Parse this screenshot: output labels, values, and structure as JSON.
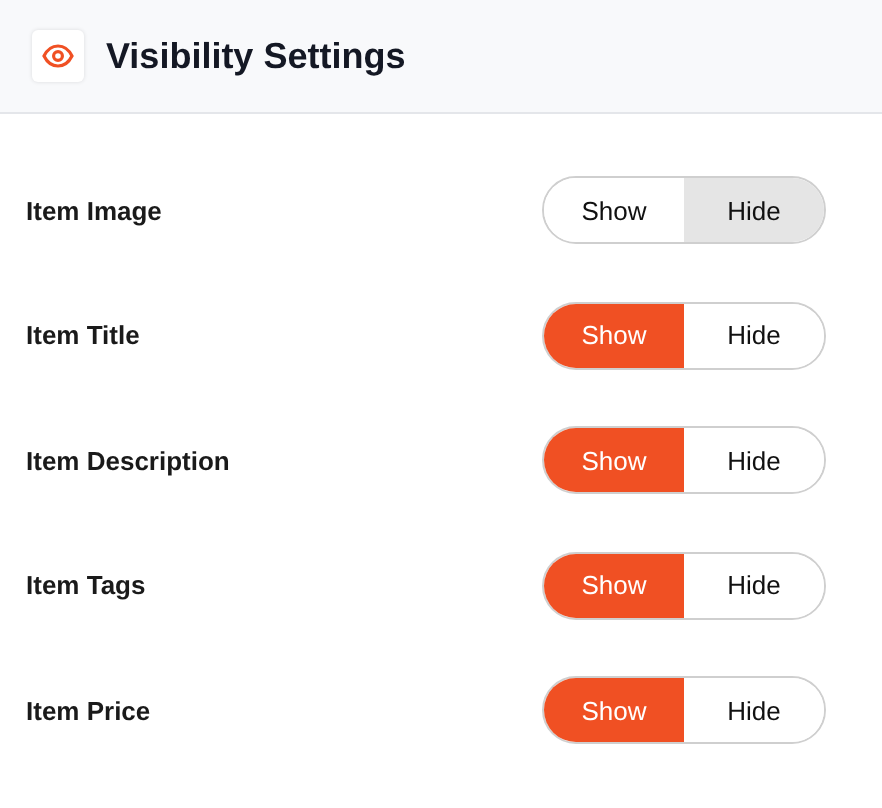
{
  "header": {
    "title": "Visibility Settings"
  },
  "settings": [
    {
      "label": "Item Image",
      "options": [
        {
          "kind": "show",
          "label": "Show",
          "selected": false
        },
        {
          "kind": "hide",
          "label": "Hide",
          "selected": true
        }
      ]
    },
    {
      "label": "Item Title",
      "options": [
        {
          "kind": "show",
          "label": "Show",
          "selected": true
        },
        {
          "kind": "hide",
          "label": "Hide",
          "selected": false
        }
      ]
    },
    {
      "label": "Item Description",
      "options": [
        {
          "kind": "show",
          "label": "Show",
          "selected": true
        },
        {
          "kind": "hide",
          "label": "Hide",
          "selected": false
        }
      ]
    },
    {
      "label": "Item Tags",
      "options": [
        {
          "kind": "show",
          "label": "Show",
          "selected": true
        },
        {
          "kind": "hide",
          "label": "Hide",
          "selected": false
        }
      ]
    },
    {
      "label": "Item Price",
      "options": [
        {
          "kind": "show",
          "label": "Show",
          "selected": true
        },
        {
          "kind": "hide",
          "label": "Hide",
          "selected": false
        }
      ]
    }
  ]
}
